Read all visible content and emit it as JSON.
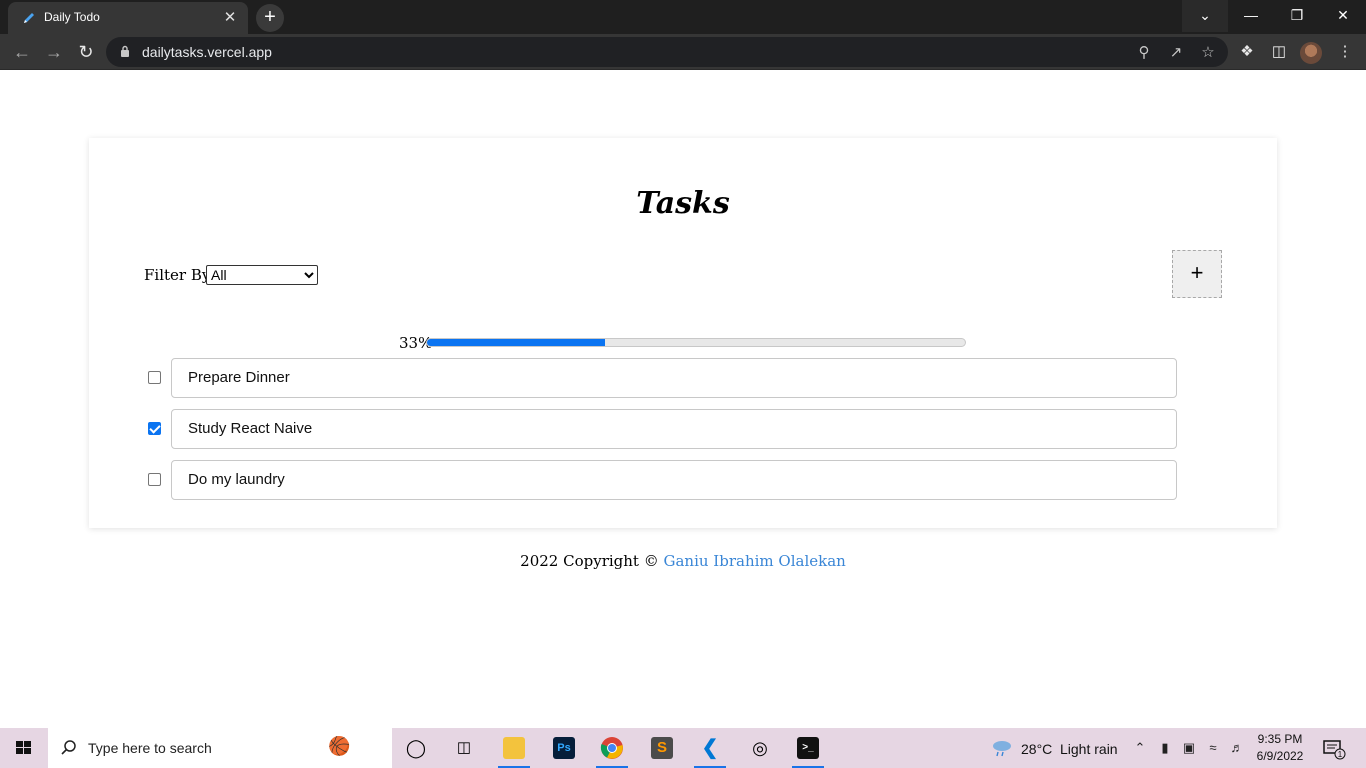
{
  "browser": {
    "tab_title": "Daily Todo",
    "tab_close_glyph": "✕",
    "new_tab_glyph": "+",
    "url": "dailytasks.vercel.app",
    "icons": [
      "back-arrow-icon",
      "forward-arrow-icon",
      "reload-icon",
      "lock-icon",
      "zoom-icon",
      "share-icon",
      "bookmark-star-icon",
      "extensions-icon",
      "side-panel-icon",
      "profile-avatar",
      "more-menu-icon"
    ],
    "window_controls": [
      "tab-search",
      "minimize",
      "maximize",
      "close"
    ]
  },
  "app": {
    "heading": "Tasks",
    "filter_label": "Filter By:",
    "filter_selected": "All",
    "add_button_label": "+",
    "progress_percent": 33,
    "progress_label": "33%",
    "progress_color": "#0b74f1",
    "tasks": [
      {
        "text": "Prepare Dinner",
        "done": false
      },
      {
        "text": "Study React Naive",
        "done": true
      },
      {
        "text": "Do my laundry",
        "done": false
      }
    ],
    "footer_prefix": "2022 Copyright © ",
    "footer_author": "Ganiu Ibrahim Olalekan",
    "link_color": "#3a86d6"
  },
  "taskbar": {
    "search_placeholder": "Type here to search",
    "apps": [
      "cortana",
      "task-view",
      "file-explorer",
      "photoshop",
      "chrome",
      "sublime-text",
      "vscode",
      "media-app",
      "terminal"
    ],
    "weather_temp": "28°C",
    "weather_condition": "Light rain",
    "time": "9:35 PM",
    "date": "6/9/2022",
    "notification_count": "1"
  }
}
